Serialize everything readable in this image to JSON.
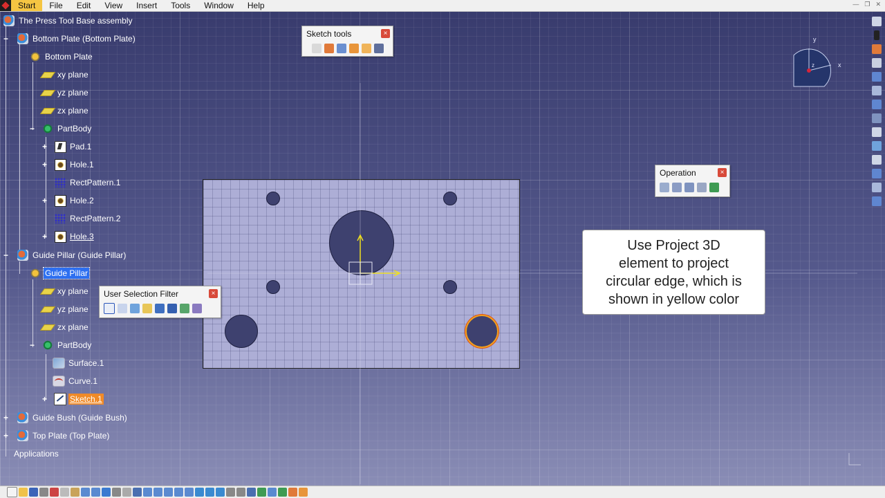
{
  "menu": {
    "items": [
      {
        "label": "Start",
        "active": true
      },
      {
        "label": "File"
      },
      {
        "label": "Edit"
      },
      {
        "label": "View"
      },
      {
        "label": "Insert"
      },
      {
        "label": "Tools"
      },
      {
        "label": "Window"
      },
      {
        "label": "Help"
      }
    ]
  },
  "tree": {
    "nodes": [
      {
        "label": "The Press Tool Base assembly",
        "icon": "assembly-icon"
      },
      {
        "label": "Bottom Plate (Bottom Plate)",
        "icon": "assembly-icon"
      },
      {
        "label": "Bottom Plate",
        "icon": "part-icon"
      },
      {
        "label": "xy plane",
        "icon": "plane-icon"
      },
      {
        "label": "yz plane",
        "icon": "plane-icon"
      },
      {
        "label": "zx plane",
        "icon": "plane-icon"
      },
      {
        "label": "PartBody",
        "icon": "body-icon"
      },
      {
        "label": "Pad.1",
        "icon": "pad-icon"
      },
      {
        "label": "Hole.1",
        "icon": "hole-icon"
      },
      {
        "label": "RectPattern.1",
        "icon": "pattern-icon"
      },
      {
        "label": "Hole.2",
        "icon": "hole-icon"
      },
      {
        "label": "RectPattern.2",
        "icon": "pattern-icon"
      },
      {
        "label": "Hole.3",
        "icon": "hole-icon"
      },
      {
        "label": "Guide Pillar (Guide Pillar)",
        "icon": "assembly-icon"
      },
      {
        "label": "Guide Pillar",
        "icon": "part-icon"
      },
      {
        "label": "xy plane",
        "icon": "plane-icon"
      },
      {
        "label": "yz plane",
        "icon": "plane-icon"
      },
      {
        "label": "zx plane",
        "icon": "plane-icon"
      },
      {
        "label": "PartBody",
        "icon": "body-icon"
      },
      {
        "label": "Surface.1",
        "icon": "surface-icon"
      },
      {
        "label": "Curve.1",
        "icon": "curve-icon"
      },
      {
        "label": "Sketch.1",
        "icon": "sketch-icon"
      },
      {
        "label": "Guide Bush (Guide Bush)",
        "icon": "assembly-icon"
      },
      {
        "label": "Top Plate (Top Plate)",
        "icon": "assembly-icon"
      },
      {
        "label": "Applications",
        "icon": ""
      }
    ]
  },
  "toolbars": {
    "sketch_tools": {
      "title": "Sketch tools",
      "close": "×"
    },
    "operation": {
      "title": "Operation",
      "close": "×"
    },
    "user_selection_filter": {
      "title": "User Selection Filter",
      "close": "×"
    }
  },
  "compass": {
    "x_label": "x",
    "y_label": "y",
    "z_label": "z"
  },
  "callout": {
    "lines": [
      "Use Project 3D",
      "element to project",
      "circular edge, which is",
      "shown in yellow color"
    ]
  },
  "colors": {
    "background": "#4a4d80",
    "plate": "#adaed6",
    "hole": "#3e416f",
    "highlight_edge": "#f0a020",
    "selection_blue": "#2d6ff0",
    "selection_orange": "#f08a28",
    "axis_yellow": "#f0e020"
  }
}
